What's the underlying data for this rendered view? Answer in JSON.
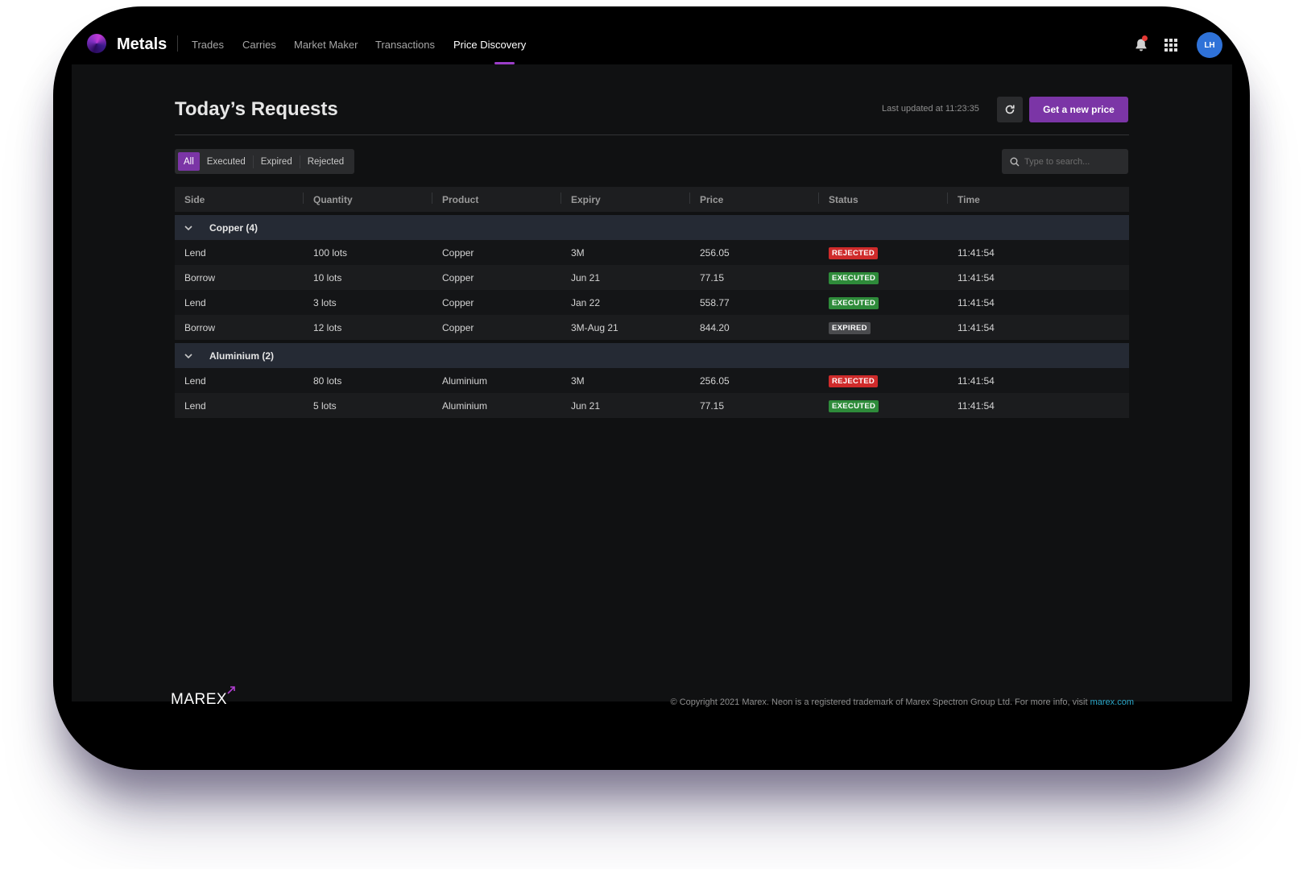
{
  "app": {
    "title": "Metals"
  },
  "nav": {
    "items": [
      {
        "label": "Trades"
      },
      {
        "label": "Carries"
      },
      {
        "label": "Market Maker"
      },
      {
        "label": "Transactions"
      },
      {
        "label": "Price Discovery"
      }
    ],
    "active": "Price Discovery"
  },
  "user": {
    "initials": "LH"
  },
  "colors": {
    "accent": "#7b35a6",
    "rejected": "#cf2b2b",
    "executed": "#2e8b3a",
    "expired": "#4a4b4e",
    "link": "#2aa6c8"
  },
  "page": {
    "title": "Today’s Requests",
    "last_updated": "Last updated at 11:23:35",
    "primary_button": "Get a new price"
  },
  "filters": {
    "items": [
      "All",
      "Executed",
      "Expired",
      "Rejected"
    ],
    "selected": "All"
  },
  "search": {
    "placeholder": "Type to search..."
  },
  "table": {
    "columns": [
      "Side",
      "Quantity",
      "Product",
      "Expiry",
      "Price",
      "Status",
      "Time"
    ],
    "groups": [
      {
        "label": "Copper (4)",
        "rows": [
          {
            "side": "Lend",
            "quantity": "100 lots",
            "product": "Copper",
            "expiry": "3M",
            "price": "256.05",
            "status": "REJECTED",
            "time": "11:41:54"
          },
          {
            "side": "Borrow",
            "quantity": "10 lots",
            "product": "Copper",
            "expiry": "Jun 21",
            "price": "77.15",
            "status": "EXECUTED",
            "time": "11:41:54"
          },
          {
            "side": "Lend",
            "quantity": "3 lots",
            "product": "Copper",
            "expiry": "Jan 22",
            "price": "558.77",
            "status": "EXECUTED",
            "time": "11:41:54"
          },
          {
            "side": "Borrow",
            "quantity": "12 lots",
            "product": "Copper",
            "expiry": "3M-Aug 21",
            "price": "844.20",
            "status": "EXPIRED",
            "time": "11:41:54"
          }
        ]
      },
      {
        "label": "Aluminium (2)",
        "rows": [
          {
            "side": "Lend",
            "quantity": "80 lots",
            "product": "Aluminium",
            "expiry": "3M",
            "price": "256.05",
            "status": "REJECTED",
            "time": "11:41:54"
          },
          {
            "side": "Lend",
            "quantity": "5 lots",
            "product": "Aluminium",
            "expiry": "Jun 21",
            "price": "77.15",
            "status": "EXECUTED",
            "time": "11:41:54"
          }
        ]
      }
    ]
  },
  "footer": {
    "logo": "MAREX",
    "copyright": "© Copyright 2021 Marex. Neon is a registered trademark of Marex Spectron Group Ltd. For more info, visit ",
    "link": "marex.com"
  }
}
